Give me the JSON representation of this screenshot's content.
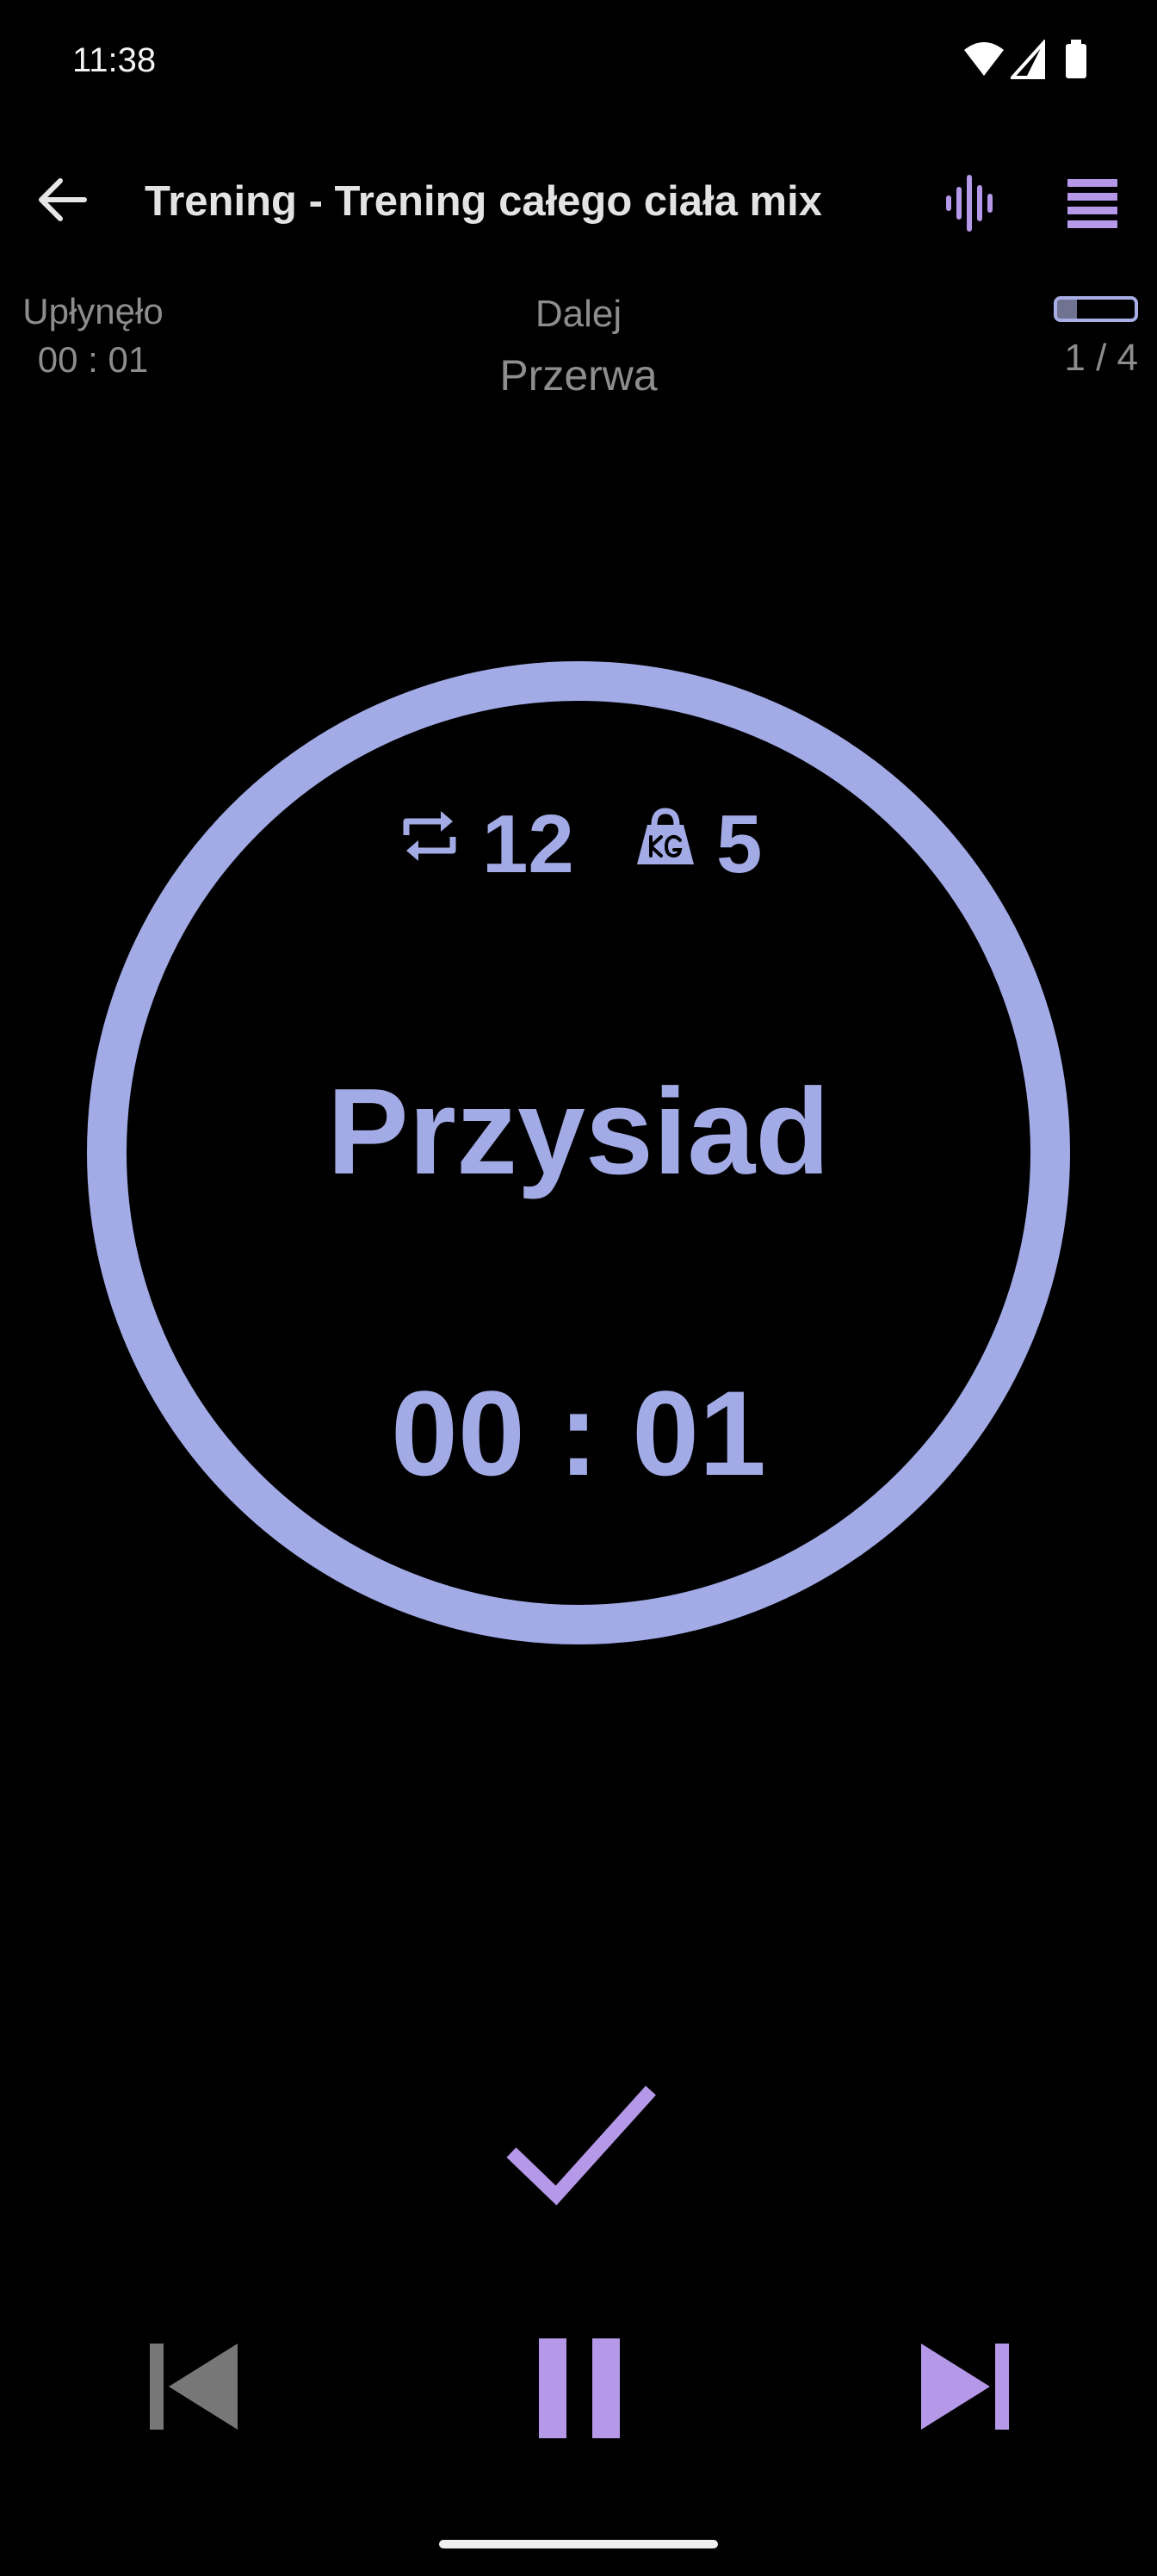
{
  "status_bar": {
    "time": "11:38",
    "icons": [
      "wifi-icon",
      "cell-signal-icon",
      "battery-icon"
    ]
  },
  "app_bar": {
    "title": "Trening - Trening całego ciała mix",
    "back_icon": "arrow-back-icon",
    "voice_icon": "audio-waveform-icon",
    "menu_icon": "list-menu-icon"
  },
  "info": {
    "elapsed_label": "Upłynęło",
    "elapsed_value": "00 : 01",
    "next_label": "Dalej",
    "next_value": "Przerwa",
    "progress_text": "1 / 4",
    "progress_fraction": 0.25
  },
  "exercise": {
    "reps": "12",
    "weight": "5",
    "name": "Przysiad",
    "timer": "00 : 01"
  },
  "colors": {
    "accent": "#a2abe6",
    "accent_purple": "#b598e8",
    "muted_text": "#8d8d8d",
    "background": "#000000",
    "disabled_control": "#777777"
  },
  "controls": {
    "complete_icon": "checkmark-icon",
    "previous_icon": "skip-previous-icon",
    "pause_icon": "pause-icon",
    "next_icon": "skip-next-icon"
  }
}
